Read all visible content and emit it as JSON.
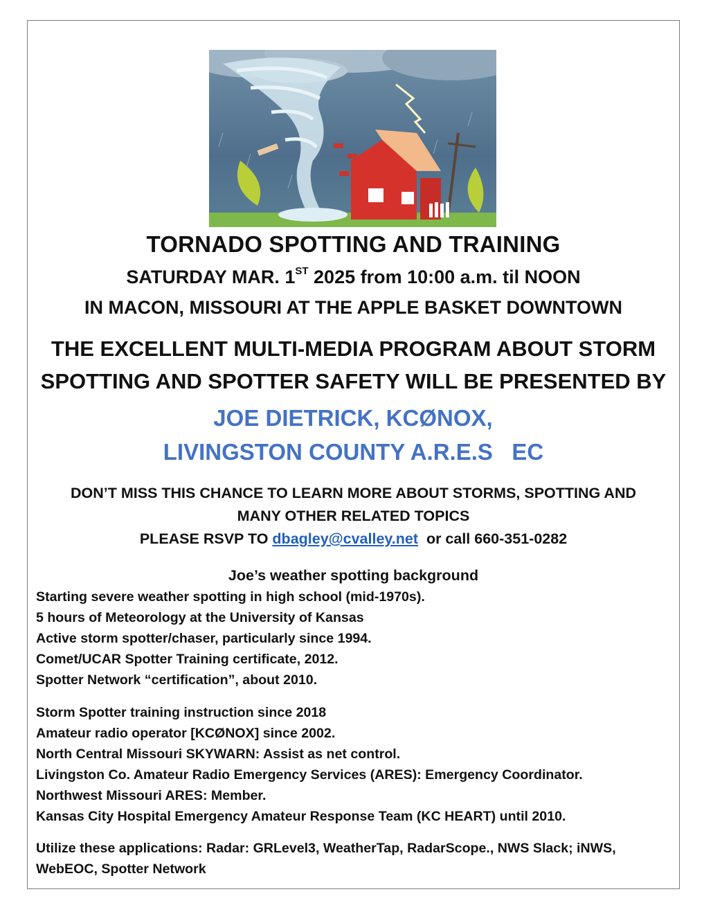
{
  "illustration": {
    "icon": "tornado-house-illustration"
  },
  "header": {
    "title": "TORNADO SPOTTING AND TRAINING",
    "date_prefix": "SATURDAY MAR. 1",
    "date_suffix": "ST",
    "date_rest": " 2025 from 10:00 a.m. til NOON",
    "location": "IN MACON, MISSOURI AT THE APPLE BASKET DOWNTOWN"
  },
  "program": {
    "line1": "THE EXCELLENT MULTI-MEDIA PROGRAM ABOUT STORM",
    "line2": "SPOTTING AND SPOTTER SAFETY WILL BE PRESENTED BY",
    "presenter": "JOE DIETRICK, KCØNOX,",
    "affiliation": "LIVINGSTON COUNTY A.R.E.S   EC",
    "accent_color": "#4472c4"
  },
  "invite": {
    "line1": "DON’T MISS THIS CHANCE TO LEARN MORE ABOUT STORMS, SPOTTING AND",
    "line2": "MANY OTHER RELATED TOPICS",
    "rsvp_prefix": "PLEASE RSVP TO ",
    "email": "dbagley@cvalley.net",
    "rsvp_suffix": "  or call 660-351-0282"
  },
  "background": {
    "heading": "Joe’s weather spotting background",
    "group1": [
      "Starting severe weather spotting in high school (mid-1970s).",
      "5 hours of Meteorology at the University of Kansas",
      "Active storm spotter/chaser, particularly since 1994.",
      "Comet/UCAR Spotter Training certificate, 2012.",
      "Spotter Network “certification”, about 2010."
    ],
    "group2": [
      "Storm Spotter training instruction since 2018",
      "Amateur radio operator [KCØNOX] since 2002.",
      "North Central Missouri SKYWARN: Assist as net control.",
      "Livingston Co. Amateur Radio Emergency Services (ARES): Emergency Coordinator.",
      "Northwest Missouri ARES: Member.",
      "Kansas City Hospital Emergency Amateur Response Team (KC HEART) until 2010."
    ],
    "applications": "Utilize these applications: Radar: GRLevel3, WeatherTap, RadarScope., NWS Slack; iNWS, WebEOC, Spotter Network"
  }
}
